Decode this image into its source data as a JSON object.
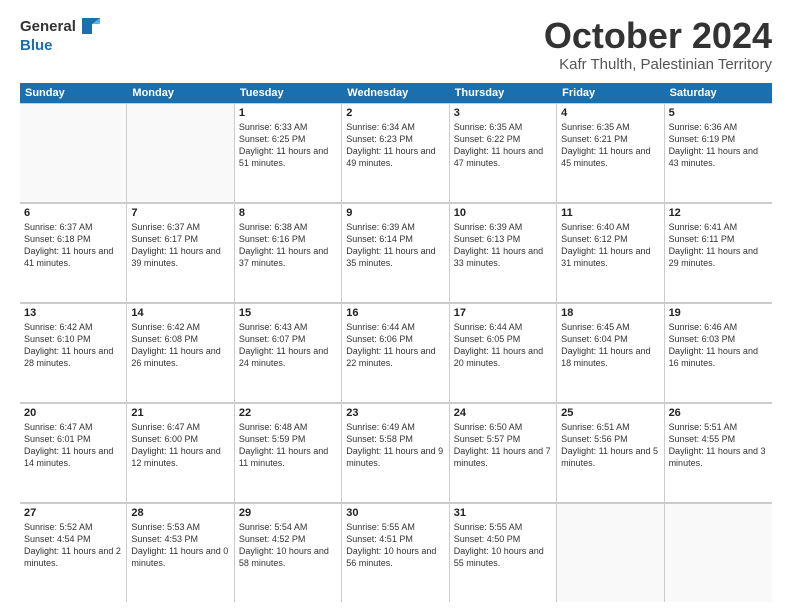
{
  "header": {
    "logo_general": "General",
    "logo_blue": "Blue",
    "title": "October 2024",
    "subtitle": "Kafr Thulth, Palestinian Territory"
  },
  "days_of_week": [
    "Sunday",
    "Monday",
    "Tuesday",
    "Wednesday",
    "Thursday",
    "Friday",
    "Saturday"
  ],
  "weeks": [
    [
      {
        "day": "",
        "empty": true
      },
      {
        "day": "",
        "empty": true
      },
      {
        "day": "1",
        "sunrise": "Sunrise: 6:33 AM",
        "sunset": "Sunset: 6:25 PM",
        "daylight": "Daylight: 11 hours and 51 minutes."
      },
      {
        "day": "2",
        "sunrise": "Sunrise: 6:34 AM",
        "sunset": "Sunset: 6:23 PM",
        "daylight": "Daylight: 11 hours and 49 minutes."
      },
      {
        "day": "3",
        "sunrise": "Sunrise: 6:35 AM",
        "sunset": "Sunset: 6:22 PM",
        "daylight": "Daylight: 11 hours and 47 minutes."
      },
      {
        "day": "4",
        "sunrise": "Sunrise: 6:35 AM",
        "sunset": "Sunset: 6:21 PM",
        "daylight": "Daylight: 11 hours and 45 minutes."
      },
      {
        "day": "5",
        "sunrise": "Sunrise: 6:36 AM",
        "sunset": "Sunset: 6:19 PM",
        "daylight": "Daylight: 11 hours and 43 minutes."
      }
    ],
    [
      {
        "day": "6",
        "sunrise": "Sunrise: 6:37 AM",
        "sunset": "Sunset: 6:18 PM",
        "daylight": "Daylight: 11 hours and 41 minutes."
      },
      {
        "day": "7",
        "sunrise": "Sunrise: 6:37 AM",
        "sunset": "Sunset: 6:17 PM",
        "daylight": "Daylight: 11 hours and 39 minutes."
      },
      {
        "day": "8",
        "sunrise": "Sunrise: 6:38 AM",
        "sunset": "Sunset: 6:16 PM",
        "daylight": "Daylight: 11 hours and 37 minutes."
      },
      {
        "day": "9",
        "sunrise": "Sunrise: 6:39 AM",
        "sunset": "Sunset: 6:14 PM",
        "daylight": "Daylight: 11 hours and 35 minutes."
      },
      {
        "day": "10",
        "sunrise": "Sunrise: 6:39 AM",
        "sunset": "Sunset: 6:13 PM",
        "daylight": "Daylight: 11 hours and 33 minutes."
      },
      {
        "day": "11",
        "sunrise": "Sunrise: 6:40 AM",
        "sunset": "Sunset: 6:12 PM",
        "daylight": "Daylight: 11 hours and 31 minutes."
      },
      {
        "day": "12",
        "sunrise": "Sunrise: 6:41 AM",
        "sunset": "Sunset: 6:11 PM",
        "daylight": "Daylight: 11 hours and 29 minutes."
      }
    ],
    [
      {
        "day": "13",
        "sunrise": "Sunrise: 6:42 AM",
        "sunset": "Sunset: 6:10 PM",
        "daylight": "Daylight: 11 hours and 28 minutes."
      },
      {
        "day": "14",
        "sunrise": "Sunrise: 6:42 AM",
        "sunset": "Sunset: 6:08 PM",
        "daylight": "Daylight: 11 hours and 26 minutes."
      },
      {
        "day": "15",
        "sunrise": "Sunrise: 6:43 AM",
        "sunset": "Sunset: 6:07 PM",
        "daylight": "Daylight: 11 hours and 24 minutes."
      },
      {
        "day": "16",
        "sunrise": "Sunrise: 6:44 AM",
        "sunset": "Sunset: 6:06 PM",
        "daylight": "Daylight: 11 hours and 22 minutes."
      },
      {
        "day": "17",
        "sunrise": "Sunrise: 6:44 AM",
        "sunset": "Sunset: 6:05 PM",
        "daylight": "Daylight: 11 hours and 20 minutes."
      },
      {
        "day": "18",
        "sunrise": "Sunrise: 6:45 AM",
        "sunset": "Sunset: 6:04 PM",
        "daylight": "Daylight: 11 hours and 18 minutes."
      },
      {
        "day": "19",
        "sunrise": "Sunrise: 6:46 AM",
        "sunset": "Sunset: 6:03 PM",
        "daylight": "Daylight: 11 hours and 16 minutes."
      }
    ],
    [
      {
        "day": "20",
        "sunrise": "Sunrise: 6:47 AM",
        "sunset": "Sunset: 6:01 PM",
        "daylight": "Daylight: 11 hours and 14 minutes."
      },
      {
        "day": "21",
        "sunrise": "Sunrise: 6:47 AM",
        "sunset": "Sunset: 6:00 PM",
        "daylight": "Daylight: 11 hours and 12 minutes."
      },
      {
        "day": "22",
        "sunrise": "Sunrise: 6:48 AM",
        "sunset": "Sunset: 5:59 PM",
        "daylight": "Daylight: 11 hours and 11 minutes."
      },
      {
        "day": "23",
        "sunrise": "Sunrise: 6:49 AM",
        "sunset": "Sunset: 5:58 PM",
        "daylight": "Daylight: 11 hours and 9 minutes."
      },
      {
        "day": "24",
        "sunrise": "Sunrise: 6:50 AM",
        "sunset": "Sunset: 5:57 PM",
        "daylight": "Daylight: 11 hours and 7 minutes."
      },
      {
        "day": "25",
        "sunrise": "Sunrise: 6:51 AM",
        "sunset": "Sunset: 5:56 PM",
        "daylight": "Daylight: 11 hours and 5 minutes."
      },
      {
        "day": "26",
        "sunrise": "Sunrise: 5:51 AM",
        "sunset": "Sunset: 4:55 PM",
        "daylight": "Daylight: 11 hours and 3 minutes."
      }
    ],
    [
      {
        "day": "27",
        "sunrise": "Sunrise: 5:52 AM",
        "sunset": "Sunset: 4:54 PM",
        "daylight": "Daylight: 11 hours and 2 minutes."
      },
      {
        "day": "28",
        "sunrise": "Sunrise: 5:53 AM",
        "sunset": "Sunset: 4:53 PM",
        "daylight": "Daylight: 11 hours and 0 minutes."
      },
      {
        "day": "29",
        "sunrise": "Sunrise: 5:54 AM",
        "sunset": "Sunset: 4:52 PM",
        "daylight": "Daylight: 10 hours and 58 minutes."
      },
      {
        "day": "30",
        "sunrise": "Sunrise: 5:55 AM",
        "sunset": "Sunset: 4:51 PM",
        "daylight": "Daylight: 10 hours and 56 minutes."
      },
      {
        "day": "31",
        "sunrise": "Sunrise: 5:55 AM",
        "sunset": "Sunset: 4:50 PM",
        "daylight": "Daylight: 10 hours and 55 minutes."
      },
      {
        "day": "",
        "empty": true
      },
      {
        "day": "",
        "empty": true
      }
    ]
  ]
}
